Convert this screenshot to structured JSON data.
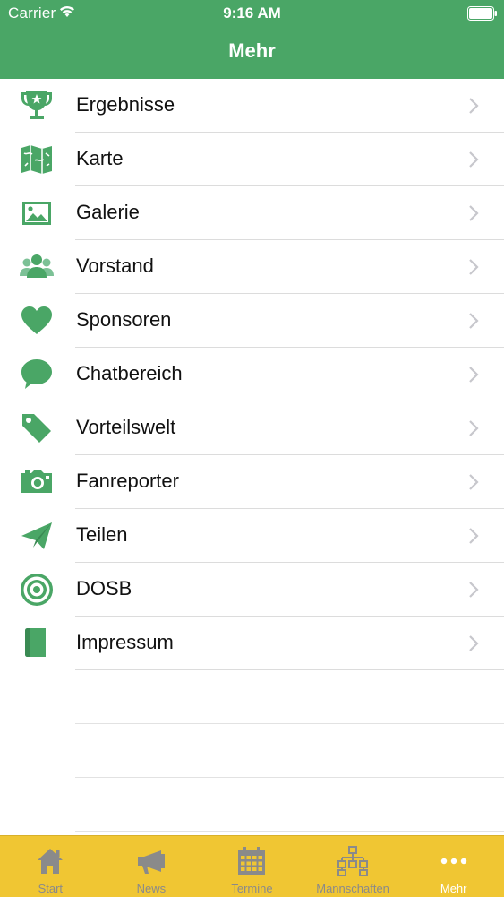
{
  "status_bar": {
    "carrier": "Carrier",
    "time": "9:16 AM"
  },
  "nav": {
    "title": "Mehr"
  },
  "colors": {
    "nav_green": "#4aa666",
    "icon_green": "#4aa666",
    "tabbar_yellow": "#f0c633",
    "tab_inactive": "#8a8a8a",
    "tab_active": "#ffffff"
  },
  "menu": {
    "items": [
      {
        "label": "Ergebnisse",
        "icon": "trophy-icon"
      },
      {
        "label": "Karte",
        "icon": "map-icon"
      },
      {
        "label": "Galerie",
        "icon": "image-icon"
      },
      {
        "label": "Vorstand",
        "icon": "people-icon"
      },
      {
        "label": "Sponsoren",
        "icon": "heart-icon"
      },
      {
        "label": "Chatbereich",
        "icon": "chat-bubble-icon"
      },
      {
        "label": "Vorteilswelt",
        "icon": "tag-icon"
      },
      {
        "label": "Fanreporter",
        "icon": "camera-icon"
      },
      {
        "label": "Teilen",
        "icon": "paper-plane-icon"
      },
      {
        "label": "DOSB",
        "icon": "target-icon"
      },
      {
        "label": "Impressum",
        "icon": "book-icon"
      }
    ]
  },
  "tabbar": {
    "tabs": [
      {
        "label": "Start",
        "icon": "home-icon",
        "active": false
      },
      {
        "label": "News",
        "icon": "megaphone-icon",
        "active": false
      },
      {
        "label": "Termine",
        "icon": "calendar-icon",
        "active": false
      },
      {
        "label": "Mannschaften",
        "icon": "org-chart-icon",
        "active": false
      },
      {
        "label": "Mehr",
        "icon": "more-dots-icon",
        "active": true
      }
    ]
  }
}
